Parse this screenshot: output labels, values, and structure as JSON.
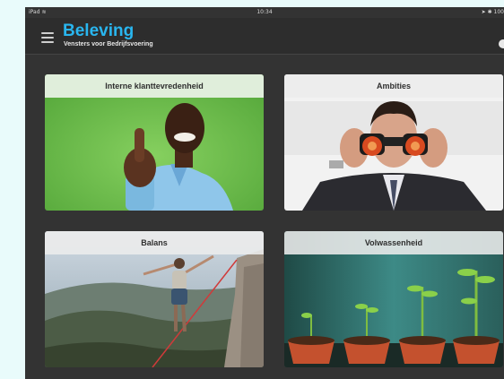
{
  "status": {
    "carrier": "iPad",
    "time": "10:34",
    "battery": "100"
  },
  "app": {
    "title": "Beleving",
    "subtitle": "Vensters voor Bedrijfsvoering"
  },
  "tiles": [
    {
      "title": "Interne klanttevredenheid",
      "image": "thumbs-up-man-photo"
    },
    {
      "title": "Ambities",
      "image": "man-with-binoculars-photo"
    },
    {
      "title": "Balans",
      "image": "slackline-walker-photo"
    },
    {
      "title": "Volwassenheid",
      "image": "seedlings-in-pots-photo"
    }
  ],
  "colors": {
    "accent": "#29b6ef",
    "background": "#333333",
    "page": "#e9fbfb"
  }
}
